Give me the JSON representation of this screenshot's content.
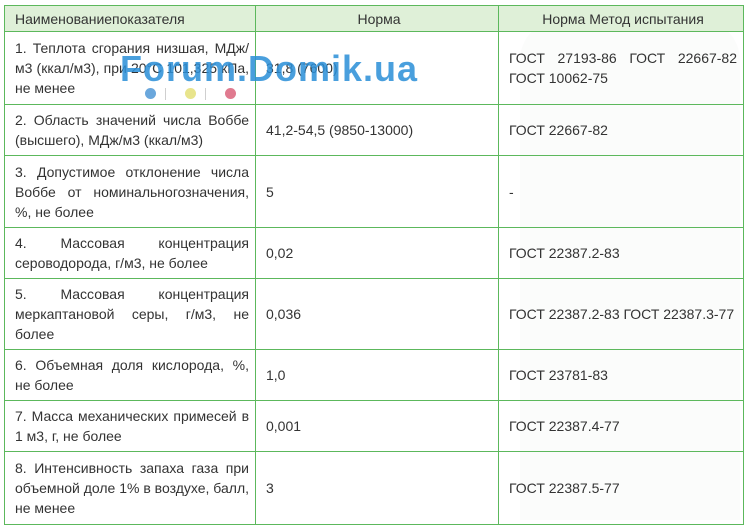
{
  "table": {
    "headers": [
      "Наименованиепоказателя",
      "Норма",
      "Норма Метод испытания"
    ],
    "rows": [
      {
        "name": "1. Теплота сгорания низшая, МДж/м3 (ккал/м3), при 20°С 101,325 кПа, не менее",
        "norm": "31,8 (7600)",
        "method": "ГОСТ 27193-86 ГОСТ 22667-82 ГОСТ 10062-75"
      },
      {
        "name": "2. Область значений числа Воббе (высшего), МДж/м3 (ккал/м3)",
        "norm": "41,2-54,5 (9850-13000)",
        "method": "ГОСТ 22667-82"
      },
      {
        "name": "3. Допустимое отклонение числа Воббе от номинальногозначения, %, не более",
        "norm": "5",
        "method": "-"
      },
      {
        "name": "4. Массовая концентрация сероводорода, г/м3, не более",
        "norm": "0,02",
        "method": "ГОСТ 22387.2-83"
      },
      {
        "name": "5. Массовая концентрация меркаптановой серы, г/м3, не более",
        "norm": "0,036",
        "method": "ГОСТ 22387.2-83 ГОСТ 22387.3-77"
      },
      {
        "name": "6. Объемная доля кислорода, %, не более",
        "norm": "1,0",
        "method": "ГОСТ 23781-83"
      },
      {
        "name": "7. Масса механических примесей в 1 м3, г, не более",
        "norm": "0,001",
        "method": "ГОСТ 22387.4-77"
      },
      {
        "name": "8. Интенсивность запаха газа при объемной доле 1% в воздухе, балл, не менее",
        "norm": "3",
        "method": "ГОСТ 22387.5-77"
      }
    ]
  },
  "watermark": {
    "text": "Forum.Domik.ua",
    "color": "#2a8fd8"
  },
  "colors": {
    "border": "#5cb85c",
    "header_bg": "#dff0d8"
  }
}
